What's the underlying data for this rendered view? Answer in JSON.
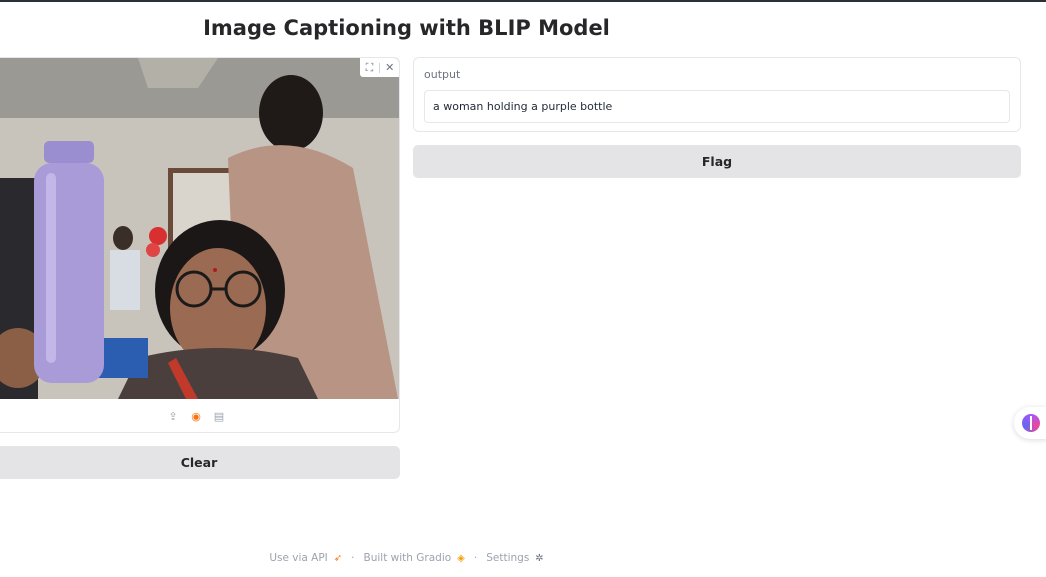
{
  "header": {
    "title": "Image Captioning with BLIP Model"
  },
  "image_input": {
    "toolbar": {
      "fullscreen_icon": "fullscreen-icon",
      "close_icon": "close-icon"
    },
    "sources": [
      "upload-icon",
      "webcam-icon",
      "clipboard-icon"
    ],
    "active_source": "webcam-icon",
    "clear_label": "Clear"
  },
  "output": {
    "label": "output",
    "value": "a woman holding a purple bottle"
  },
  "flag_label": "Flag",
  "footer": {
    "api": "Use via API",
    "built": "Built with Gradio",
    "settings": "Settings"
  },
  "colors": {
    "accent": "#f97316",
    "button_bg": "#e4e4e7",
    "bottle": "#a99ad8"
  }
}
